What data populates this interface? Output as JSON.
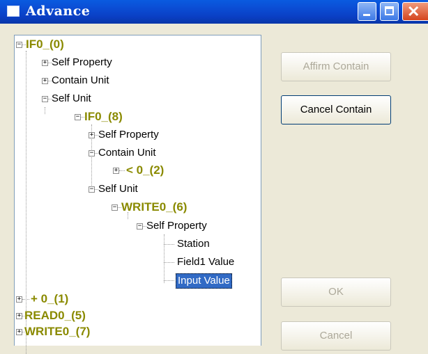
{
  "window": {
    "title": "Advance"
  },
  "tree": {
    "nodes": [
      {
        "label": "IF0_(0)",
        "expander": "−"
      },
      {
        "label": "Self Property",
        "expander": "+"
      },
      {
        "label": "Contain Unit",
        "expander": "+"
      },
      {
        "label": "Self Unit",
        "expander": "−"
      },
      {
        "label": "IF0_(8)",
        "expander": "−"
      },
      {
        "label": "Self Property",
        "expander": "+"
      },
      {
        "label": "Contain Unit",
        "expander": "−"
      },
      {
        "label": "< 0_(2)",
        "expander": "+"
      },
      {
        "label": "Self Unit",
        "expander": "−"
      },
      {
        "label": "WRITE0_(6)",
        "expander": "−"
      },
      {
        "label": "Self Property",
        "expander": "−"
      },
      {
        "label": "Station",
        "expander": ""
      },
      {
        "label": "Field1 Value",
        "expander": ""
      },
      {
        "label": "Input Value",
        "expander": ""
      },
      {
        "label": "+ 0_(1)",
        "expander": "+"
      },
      {
        "label": "READ0_(5)",
        "expander": "+"
      },
      {
        "label": "WRITE0_(7)",
        "expander": "+"
      }
    ]
  },
  "buttons": {
    "affirm_contain": "Affirm Contain",
    "cancel_contain": "Cancel Contain",
    "ok": "OK",
    "cancel": "Cancel"
  }
}
